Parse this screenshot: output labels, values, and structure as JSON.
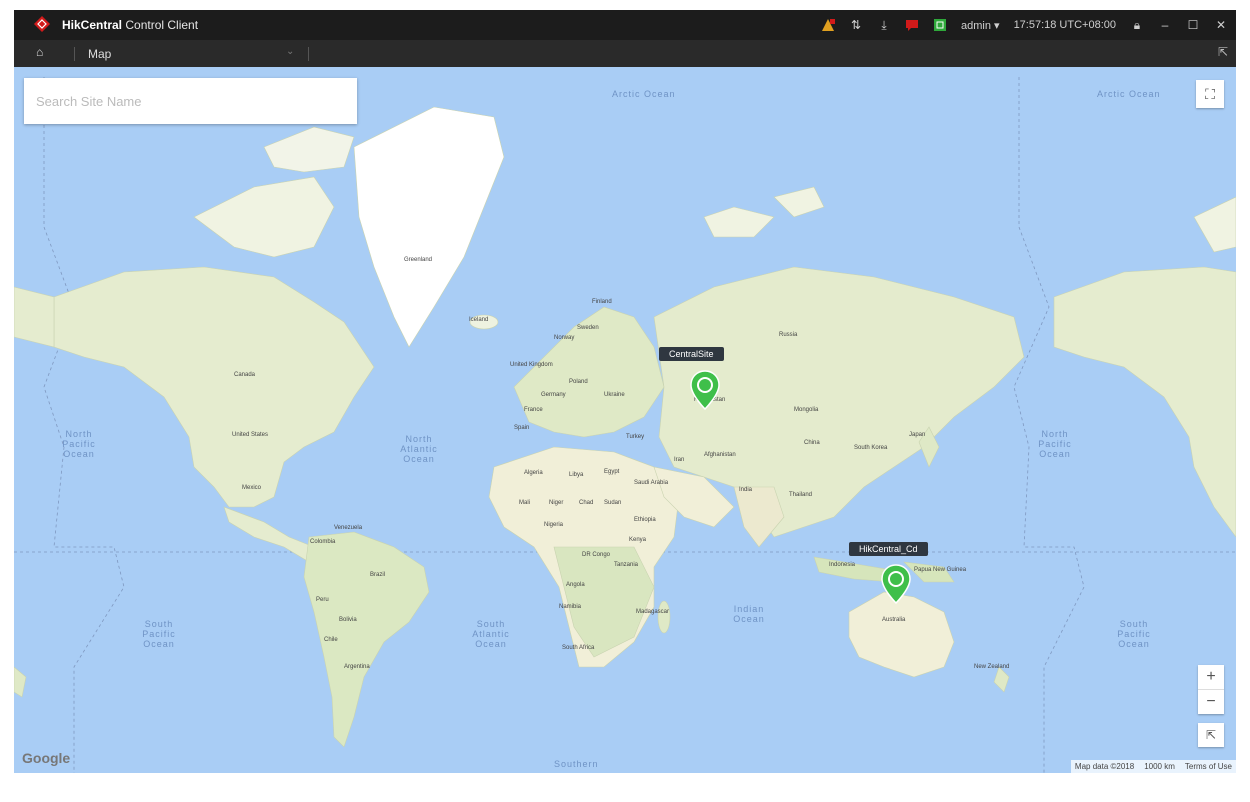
{
  "titlebar": {
    "brand_bold": "HikCentral",
    "brand_rest": " Control Client",
    "user": "admin ▾",
    "time": "17:57:18 UTC+08:00",
    "icons": [
      "alarm-icon",
      "transfer-icon",
      "download-icon",
      "message-icon",
      "status-icon",
      "lock-icon",
      "minimize-icon",
      "maximize-icon",
      "close-icon"
    ]
  },
  "nav": {
    "module": "Map"
  },
  "search": {
    "placeholder": "Search Site Name"
  },
  "oceans": {
    "arctic": "Arctic Ocean",
    "arctic_right": "Arctic Ocean",
    "north_pacific": "North Pacific Ocean",
    "north_atlantic": "North Atlantic Ocean",
    "north_pacific_right": "North Pacific Ocean",
    "south_pacific": "South Pacific Ocean",
    "south_atlantic": "South Atlantic Ocean",
    "indian": "Indian Ocean",
    "south_pacific_right": "South Pacific Ocean",
    "southern": "Southern"
  },
  "countries": {
    "greenland": "Greenland",
    "iceland": "Iceland",
    "canada": "Canada",
    "united_states": "United States",
    "mexico": "Mexico",
    "russia": "Russia",
    "kazakhstan": "Kazakhstan",
    "mongolia": "Mongolia",
    "china": "China",
    "india": "India",
    "australia": "Australia",
    "brazil": "Brazil",
    "argentina": "Argentina",
    "algeria": "Algeria",
    "libya": "Libya",
    "egypt": "Egypt",
    "mali": "Mali",
    "niger": "Niger",
    "chad": "Chad",
    "sudan": "Sudan",
    "nigeria": "Nigeria",
    "dr_congo": "DR Congo",
    "angola": "Angola",
    "namibia": "Namibia",
    "south_africa": "South Africa",
    "madagascar": "Madagascar",
    "peru": "Peru",
    "colombia": "Colombia",
    "venezuela": "Venezuela",
    "new_zealand": "New Zealand",
    "papua": "Papua New Guinea",
    "indonesia": "Indonesia",
    "iran": "Iran",
    "turkey": "Turkey",
    "saudi": "Saudi Arabia",
    "sweden": "Sweden",
    "finland": "Finland",
    "norway": "Norway",
    "uk": "United Kingdom",
    "france": "France",
    "spain": "Spain",
    "germany": "Germany",
    "poland": "Poland",
    "ukraine": "Ukraine",
    "japan": "Japan",
    "south_korea": "South Korea",
    "afghanistan": "Afghanistan",
    "thailand": "Thailand",
    "ethiopia": "Ethiopia",
    "kenya": "Kenya",
    "tanzania": "Tanzania",
    "bolivia": "Bolivia",
    "chile": "Chile"
  },
  "sites": [
    {
      "label": "CentralSite"
    },
    {
      "label": "HikCentral_Cd"
    }
  ],
  "map_controls": {
    "zoom_in": "+",
    "zoom_out": "−",
    "reset": "⇱"
  },
  "attribution": {
    "google": "Google",
    "map_data": "Map data ©2018",
    "scale": "1000 km",
    "terms": "Terms of Use"
  },
  "colors": {
    "ocean": "#a9cdf5",
    "land": "#e9efd6",
    "greenland": "#ffffff",
    "site_pin": "#3fbf4a",
    "titlebar": "#1c1c1c"
  }
}
